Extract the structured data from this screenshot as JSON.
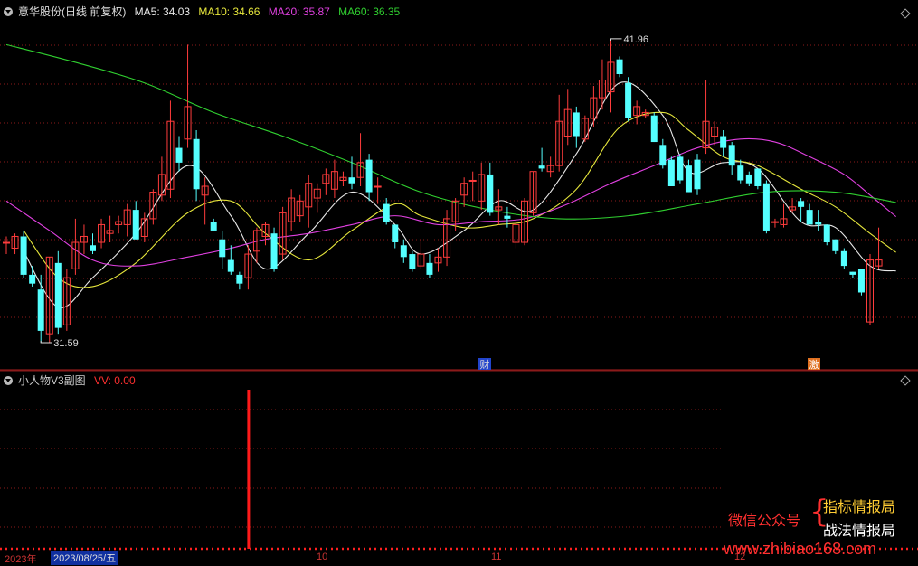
{
  "main_panel": {
    "title": "意华股份(日线 前复权)",
    "ma_labels": [
      {
        "text": "MA5: 34.03",
        "color": "#e8e8e8"
      },
      {
        "text": "MA10: 34.66",
        "color": "#e6e63c"
      },
      {
        "text": "MA20: 35.87",
        "color": "#e040e0"
      },
      {
        "text": "MA60: 36.35",
        "color": "#30d030"
      }
    ],
    "high_label": "41.96",
    "low_label": "31.59",
    "markers": [
      "财",
      "激"
    ]
  },
  "sub_panel": {
    "title": "小人物V3副图",
    "value_label": "VV: 0.00"
  },
  "x_axis": {
    "year_label": "2023年",
    "cursor_date": "2023/08/25/五",
    "month_ticks": [
      "10",
      "11",
      "12"
    ]
  },
  "watermark": {
    "left": "微信公众号",
    "line1": "指标情报局",
    "line2": "战法情报局",
    "url": "www.zhibiao168.com"
  },
  "colors": {
    "up": "#ff3c3c",
    "down": "#54ffff",
    "ma5": "#e8e8e8",
    "ma10": "#e6e63c",
    "ma20": "#e040e0",
    "ma60": "#30d030",
    "grid": "#8b1a1a",
    "signal": "#ff1a1a"
  },
  "chart_data": {
    "type": "candlestick",
    "price_range": [
      31.2,
      42.6
    ],
    "candles": [
      [
        35.0,
        35.2,
        34.6,
        35.0
      ],
      [
        34.8,
        35.3,
        34.6,
        35.2
      ],
      [
        35.2,
        35.4,
        33.8,
        33.9
      ],
      [
        33.9,
        34.2,
        33.5,
        33.6
      ],
      [
        33.4,
        33.9,
        31.6,
        32.0
      ],
      [
        31.9,
        34.5,
        31.6,
        34.5
      ],
      [
        34.3,
        34.7,
        31.9,
        32.1
      ],
      [
        32.2,
        34.1,
        32.0,
        33.8
      ],
      [
        34.1,
        35.8,
        33.9,
        35.0
      ],
      [
        35.0,
        35.6,
        34.6,
        35.2
      ],
      [
        34.9,
        35.3,
        34.6,
        34.7
      ],
      [
        35.0,
        35.8,
        34.8,
        35.6
      ],
      [
        35.3,
        35.9,
        35.0,
        35.4
      ],
      [
        35.6,
        35.9,
        35.3,
        35.7
      ],
      [
        35.6,
        36.3,
        35.2,
        36.1
      ],
      [
        36.1,
        36.4,
        35.1,
        35.1
      ],
      [
        35.2,
        36.0,
        35.0,
        35.8
      ],
      [
        35.8,
        36.8,
        35.6,
        36.7
      ],
      [
        36.6,
        37.9,
        36.4,
        37.3
      ],
      [
        36.8,
        39.8,
        36.5,
        39.1
      ],
      [
        38.2,
        38.6,
        37.4,
        37.7
      ],
      [
        38.5,
        41.7,
        38.2,
        39.6
      ],
      [
        38.5,
        38.8,
        36.4,
        36.8
      ],
      [
        36.6,
        37.2,
        35.6,
        36.9
      ],
      [
        35.7,
        35.8,
        35.4,
        35.4
      ],
      [
        35.1,
        35.4,
        34.1,
        34.5
      ],
      [
        34.4,
        34.9,
        33.9,
        34.0
      ],
      [
        33.9,
        34.0,
        33.4,
        33.6
      ],
      [
        33.8,
        34.9,
        33.4,
        34.6
      ],
      [
        34.7,
        35.5,
        34.3,
        35.4
      ],
      [
        35.2,
        35.7,
        34.9,
        35.6
      ],
      [
        35.3,
        35.5,
        34.0,
        34.1
      ],
      [
        34.6,
        36.2,
        34.4,
        36.0
      ],
      [
        35.7,
        36.8,
        35.4,
        36.5
      ],
      [
        35.9,
        36.6,
        35.7,
        36.4
      ],
      [
        36.2,
        37.3,
        35.5,
        37.0
      ],
      [
        36.5,
        37.0,
        36.0,
        36.8
      ],
      [
        37.0,
        37.5,
        36.6,
        37.3
      ],
      [
        36.8,
        37.8,
        36.5,
        37.4
      ],
      [
        37.1,
        37.4,
        36.9,
        37.2
      ],
      [
        37.2,
        37.9,
        36.8,
        37.0
      ],
      [
        37.2,
        38.7,
        36.9,
        37.7
      ],
      [
        37.8,
        38.0,
        36.4,
        36.7
      ],
      [
        36.9,
        37.2,
        36.3,
        36.9
      ],
      [
        36.3,
        36.5,
        35.6,
        35.7
      ],
      [
        35.6,
        35.6,
        34.8,
        35.0
      ],
      [
        34.9,
        35.1,
        34.3,
        34.5
      ],
      [
        34.6,
        34.7,
        34.0,
        34.1
      ],
      [
        34.2,
        35.1,
        34.1,
        34.6
      ],
      [
        34.3,
        34.6,
        33.8,
        33.9
      ],
      [
        34.3,
        34.8,
        34.0,
        34.5
      ],
      [
        34.5,
        36.1,
        34.2,
        35.8
      ],
      [
        35.7,
        36.5,
        35.4,
        36.4
      ],
      [
        36.6,
        37.2,
        36.2,
        37.0
      ],
      [
        37.1,
        37.4,
        36.4,
        37.1
      ],
      [
        36.4,
        37.7,
        36.1,
        37.3
      ],
      [
        37.3,
        37.7,
        35.9,
        36.0
      ],
      [
        36.1,
        36.8,
        35.6,
        36.2
      ],
      [
        35.9,
        36.2,
        35.5,
        35.8
      ],
      [
        35.0,
        35.8,
        34.8,
        35.6
      ],
      [
        35.0,
        36.5,
        34.9,
        36.4
      ],
      [
        36.0,
        37.4,
        35.9,
        37.4
      ],
      [
        37.6,
        38.2,
        37.4,
        37.5
      ],
      [
        37.4,
        37.9,
        37.2,
        37.6
      ],
      [
        37.6,
        40.0,
        37.4,
        39.1
      ],
      [
        38.6,
        40.2,
        38.3,
        39.5
      ],
      [
        39.4,
        39.6,
        38.2,
        38.6
      ],
      [
        38.5,
        39.3,
        38.4,
        39.2
      ],
      [
        39.2,
        40.3,
        38.9,
        39.9
      ],
      [
        39.9,
        41.2,
        39.5,
        40.5
      ],
      [
        40.1,
        41.9,
        39.4,
        41.1
      ],
      [
        41.2,
        41.3,
        40.6,
        40.7
      ],
      [
        40.4,
        40.6,
        39.1,
        39.2
      ],
      [
        39.3,
        39.8,
        39.0,
        39.6
      ],
      [
        39.3,
        39.5,
        39.2,
        39.4
      ],
      [
        39.3,
        39.4,
        38.4,
        38.4
      ],
      [
        38.3,
        38.5,
        37.5,
        37.6
      ],
      [
        37.8,
        37.9,
        36.9,
        36.9
      ],
      [
        37.9,
        38.0,
        37.0,
        37.1
      ],
      [
        37.6,
        37.8,
        36.7,
        36.7
      ],
      [
        37.8,
        38.0,
        36.6,
        36.8
      ],
      [
        38.2,
        40.5,
        38.0,
        39.1
      ],
      [
        38.6,
        39.1,
        38.3,
        38.9
      ],
      [
        38.6,
        38.8,
        37.9,
        38.2
      ],
      [
        38.3,
        38.4,
        37.3,
        37.6
      ],
      [
        37.6,
        37.8,
        37.0,
        37.1
      ],
      [
        37.3,
        37.4,
        36.9,
        37.0
      ],
      [
        37.5,
        37.5,
        36.8,
        36.9
      ],
      [
        37.0,
        37.1,
        35.3,
        35.4
      ],
      [
        35.7,
        35.8,
        35.5,
        35.7
      ],
      [
        35.6,
        36.3,
        35.5,
        35.8
      ],
      [
        36.1,
        36.5,
        36.0,
        36.2
      ],
      [
        36.4,
        36.5,
        35.7,
        36.2
      ],
      [
        36.1,
        36.3,
        35.7,
        35.6
      ],
      [
        35.7,
        36.1,
        35.4,
        35.6
      ],
      [
        35.6,
        35.6,
        34.9,
        35.0
      ],
      [
        35.1,
        35.1,
        34.6,
        34.7
      ],
      [
        34.7,
        34.8,
        34.1,
        34.2
      ],
      [
        34.0,
        34.0,
        33.8,
        33.9
      ],
      [
        34.1,
        34.1,
        33.2,
        33.3
      ],
      [
        32.3,
        34.6,
        32.2,
        34.4
      ],
      [
        34.2,
        35.5,
        34.1,
        34.4
      ]
    ],
    "ma_series": [
      {
        "name": "MA5",
        "anchors": [
          [
            2,
            34.7
          ],
          [
            6,
            32.8
          ],
          [
            10,
            33.8
          ],
          [
            15,
            35.3
          ],
          [
            21,
            37.6
          ],
          [
            26,
            35.9
          ],
          [
            30,
            34.1
          ],
          [
            35,
            35.3
          ],
          [
            40,
            36.7
          ],
          [
            45,
            35.6
          ],
          [
            48,
            34.6
          ],
          [
            53,
            35.4
          ],
          [
            57,
            36.4
          ],
          [
            61,
            36.1
          ],
          [
            66,
            38.0
          ],
          [
            71,
            40.4
          ],
          [
            76,
            39.3
          ],
          [
            79,
            37.4
          ],
          [
            83,
            37.7
          ],
          [
            87,
            37.5
          ],
          [
            92,
            35.7
          ],
          [
            96,
            35.5
          ],
          [
            100,
            34.2
          ],
          [
            103,
            34.03
          ]
        ]
      },
      {
        "name": "MA10",
        "anchors": [
          [
            2,
            35.4
          ],
          [
            6,
            33.8
          ],
          [
            10,
            33.5
          ],
          [
            15,
            34.3
          ],
          [
            21,
            36.0
          ],
          [
            26,
            36.4
          ],
          [
            30,
            35.3
          ],
          [
            35,
            34.4
          ],
          [
            40,
            35.4
          ],
          [
            45,
            36.3
          ],
          [
            48,
            35.9
          ],
          [
            53,
            35.5
          ],
          [
            57,
            35.6
          ],
          [
            61,
            35.8
          ],
          [
            66,
            36.8
          ],
          [
            71,
            38.9
          ],
          [
            76,
            39.4
          ],
          [
            79,
            38.8
          ],
          [
            83,
            37.9
          ],
          [
            87,
            37.6
          ],
          [
            92,
            36.8
          ],
          [
            96,
            36.2
          ],
          [
            100,
            35.3
          ],
          [
            103,
            34.66
          ]
        ]
      },
      {
        "name": "MA20",
        "anchors": [
          [
            0,
            36.4
          ],
          [
            5,
            35.4
          ],
          [
            10,
            34.4
          ],
          [
            15,
            34.2
          ],
          [
            21,
            34.5
          ],
          [
            26,
            34.8
          ],
          [
            30,
            35.1
          ],
          [
            35,
            35.3
          ],
          [
            40,
            35.6
          ],
          [
            45,
            35.9
          ],
          [
            50,
            35.6
          ],
          [
            55,
            35.7
          ],
          [
            60,
            35.8
          ],
          [
            65,
            36.3
          ],
          [
            70,
            37.0
          ],
          [
            75,
            37.6
          ],
          [
            80,
            38.2
          ],
          [
            85,
            38.5
          ],
          [
            89,
            38.4
          ],
          [
            93,
            37.9
          ],
          [
            97,
            37.3
          ],
          [
            100,
            36.6
          ],
          [
            103,
            35.87
          ]
        ]
      },
      {
        "name": "MA60",
        "anchors": [
          [
            0,
            41.7
          ],
          [
            8,
            41.1
          ],
          [
            16,
            40.4
          ],
          [
            24,
            39.4
          ],
          [
            32,
            38.6
          ],
          [
            40,
            37.7
          ],
          [
            48,
            36.7
          ],
          [
            56,
            36.1
          ],
          [
            64,
            35.8
          ],
          [
            72,
            35.9
          ],
          [
            80,
            36.3
          ],
          [
            88,
            36.7
          ],
          [
            96,
            36.7
          ],
          [
            103,
            36.35
          ]
        ]
      }
    ],
    "sub_indicator": {
      "name": "VV",
      "value": 0.0,
      "signal_index": 28
    }
  }
}
